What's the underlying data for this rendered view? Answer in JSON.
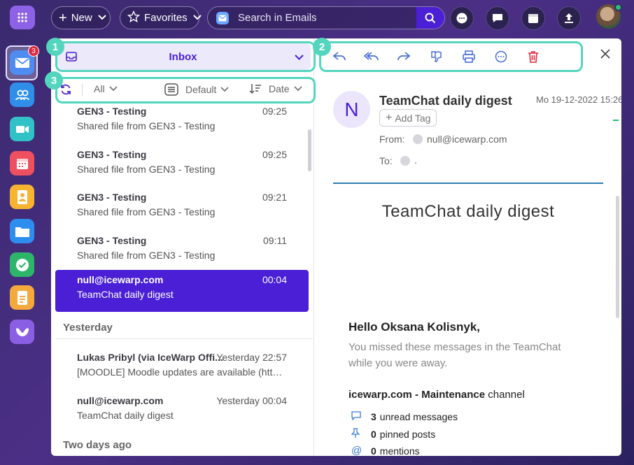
{
  "topbar": {
    "new_label": "New",
    "favorites_label": "Favorites",
    "search_placeholder": "Search in Emails"
  },
  "dock": {
    "mail_badge": "3",
    "items": [
      "mail",
      "contacts",
      "meetings",
      "calendar",
      "address-book",
      "files",
      "tasks",
      "documents",
      "teamchat"
    ]
  },
  "list": {
    "folder": "Inbox",
    "filter_all": "All",
    "view_mode": "Default",
    "sort_by": "Date",
    "messages": [
      {
        "from": "GEN3 - Testing",
        "time": "09:25",
        "subject": "Shared file from GEN3 - Testing"
      },
      {
        "from": "GEN3 - Testing",
        "time": "09:25",
        "subject": "Shared file from GEN3 - Testing"
      },
      {
        "from": "GEN3 - Testing",
        "time": "09:21",
        "subject": "Shared file from GEN3 - Testing"
      },
      {
        "from": "GEN3 - Testing",
        "time": "09:11",
        "subject": "Shared file from GEN3 - Testing"
      },
      {
        "from": "null@icewarp.com",
        "time": "00:04",
        "subject": "TeamChat daily digest",
        "selected": true
      }
    ],
    "group_yesterday": "Yesterday",
    "yesterday_messages": [
      {
        "from": "Lukas Pribyl (via IceWarp Offi...",
        "time": "Yesterday 22:57",
        "subject": "[MOODLE] Moodle updates are available (https:..."
      },
      {
        "from": "null@icewarp.com",
        "time": "Yesterday 00:04",
        "subject": "TeamChat daily digest"
      }
    ],
    "group_two_days": "Two days ago"
  },
  "reader": {
    "avatar_letter": "N",
    "subject": "TeamChat daily digest",
    "date": "Mo 19-12-2022 15:26",
    "add_tag": "Add Tag",
    "from_label": "From:",
    "from_value": "null@icewarp.com",
    "to_label": "To:",
    "to_value": ".",
    "body_title": "TeamChat daily digest",
    "greeting": "Hello Oksana Kolisnyk,",
    "missed_text": "You missed these messages in the TeamChat while you were away.",
    "channel_name": "icewarp.com - Maintenance",
    "channel_suffix": " channel",
    "stats": [
      {
        "icon": "chat-bubble-icon",
        "count": "3",
        "label": "unread messages"
      },
      {
        "icon": "pin-icon",
        "count": "0",
        "label": "pinned posts"
      },
      {
        "icon": "at-icon",
        "count": "0",
        "label": "mentions"
      }
    ]
  },
  "annotations": [
    "1",
    "2",
    "3"
  ],
  "colors": {
    "accent": "#4a1fd6",
    "highlight": "#53d6bd",
    "badge": "#e0283c",
    "delete": "#e0283c"
  }
}
